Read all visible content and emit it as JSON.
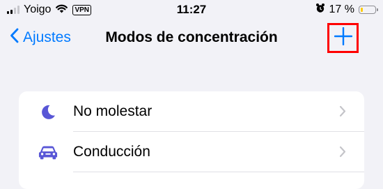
{
  "status_bar": {
    "carrier": "Yoigo",
    "vpn": "VPN",
    "time": "11:27",
    "battery_percent": "17 %",
    "battery_level": 0.17,
    "battery_color": "#ffcc00",
    "icons": [
      "signal-icon",
      "wifi-icon",
      "alarm-icon",
      "battery-icon"
    ]
  },
  "nav": {
    "back_label": "Ajustes",
    "title": "Modos de concentración",
    "add_icon": "plus-icon",
    "accent": "#007aff"
  },
  "focus_modes": [
    {
      "label": "No molestar",
      "icon": "moon-icon",
      "color": "#5856d6"
    },
    {
      "label": "Conducción",
      "icon": "car-icon",
      "color": "#5856d6"
    }
  ]
}
